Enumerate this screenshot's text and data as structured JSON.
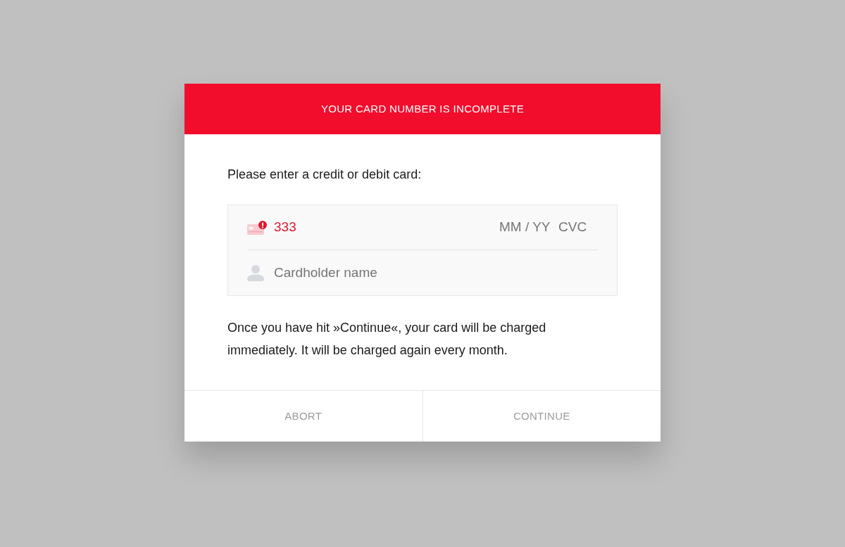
{
  "alert": {
    "message": "YOUR CARD NUMBER IS INCOMPLETE"
  },
  "prompt": "Please enter a credit or debit card:",
  "card_form": {
    "card_number": {
      "value": "333",
      "invalid": true
    },
    "expiry": {
      "placeholder": "MM / YY"
    },
    "cvc": {
      "placeholder": "CVC"
    },
    "cardholder": {
      "placeholder": "Cardholder name"
    }
  },
  "notice": "Once you have hit »Continue«, your card will be charged immediately. It will be charged again every month.",
  "buttons": [
    "ABORT",
    "CONTINUE"
  ]
}
